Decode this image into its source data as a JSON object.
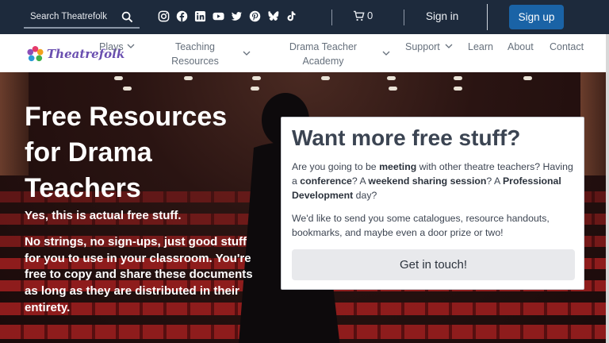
{
  "topbar": {
    "search_placeholder": "Search Theatrefolk",
    "socials": [
      "instagram-icon",
      "facebook-icon",
      "linkedin-icon",
      "youtube-icon",
      "twitter-icon",
      "pinterest-icon",
      "bluesky-icon",
      "tiktok-icon"
    ],
    "cart_count": "0",
    "signin_label": "Sign in",
    "signup_label": "Sign up"
  },
  "nav": {
    "logo_text": "Theatrefolk",
    "items": [
      {
        "label": "Plays"
      },
      {
        "label": "Teaching Resources"
      },
      {
        "label": "Drama Teacher Academy"
      },
      {
        "label": "Support"
      },
      {
        "label": "Learn"
      },
      {
        "label": "About"
      },
      {
        "label": "Contact"
      }
    ]
  },
  "hero": {
    "title": "Free Resources for Drama Teachers",
    "subtitle": "Yes, this is actual free stuff.",
    "body": "No strings, no sign-ups, just good stuff for you to use in your classroom. You're free to copy and share these documents as long as they are distributed in their entirety."
  },
  "card": {
    "heading": "Want more free stuff?",
    "p1_a": "Are you going to be ",
    "p1_b": "meeting",
    "p1_c": " with other theatre teachers? Having a ",
    "p1_d": "conference",
    "p1_e": "? A ",
    "p1_f": "weekend sharing session",
    "p1_g": "? A ",
    "p1_h": "Professional Development",
    "p1_i": " day?",
    "p2": "We'd like to send you some catalogues, resource handouts, bookmarks, and maybe even a door prize or two!",
    "cta_label": "Get in touch!"
  },
  "colors": {
    "topbar_bg": "#1d2a3c",
    "signup_bg": "#1a63a6",
    "card_heading": "#3b4452",
    "seat_red": "#9a1e1e"
  }
}
